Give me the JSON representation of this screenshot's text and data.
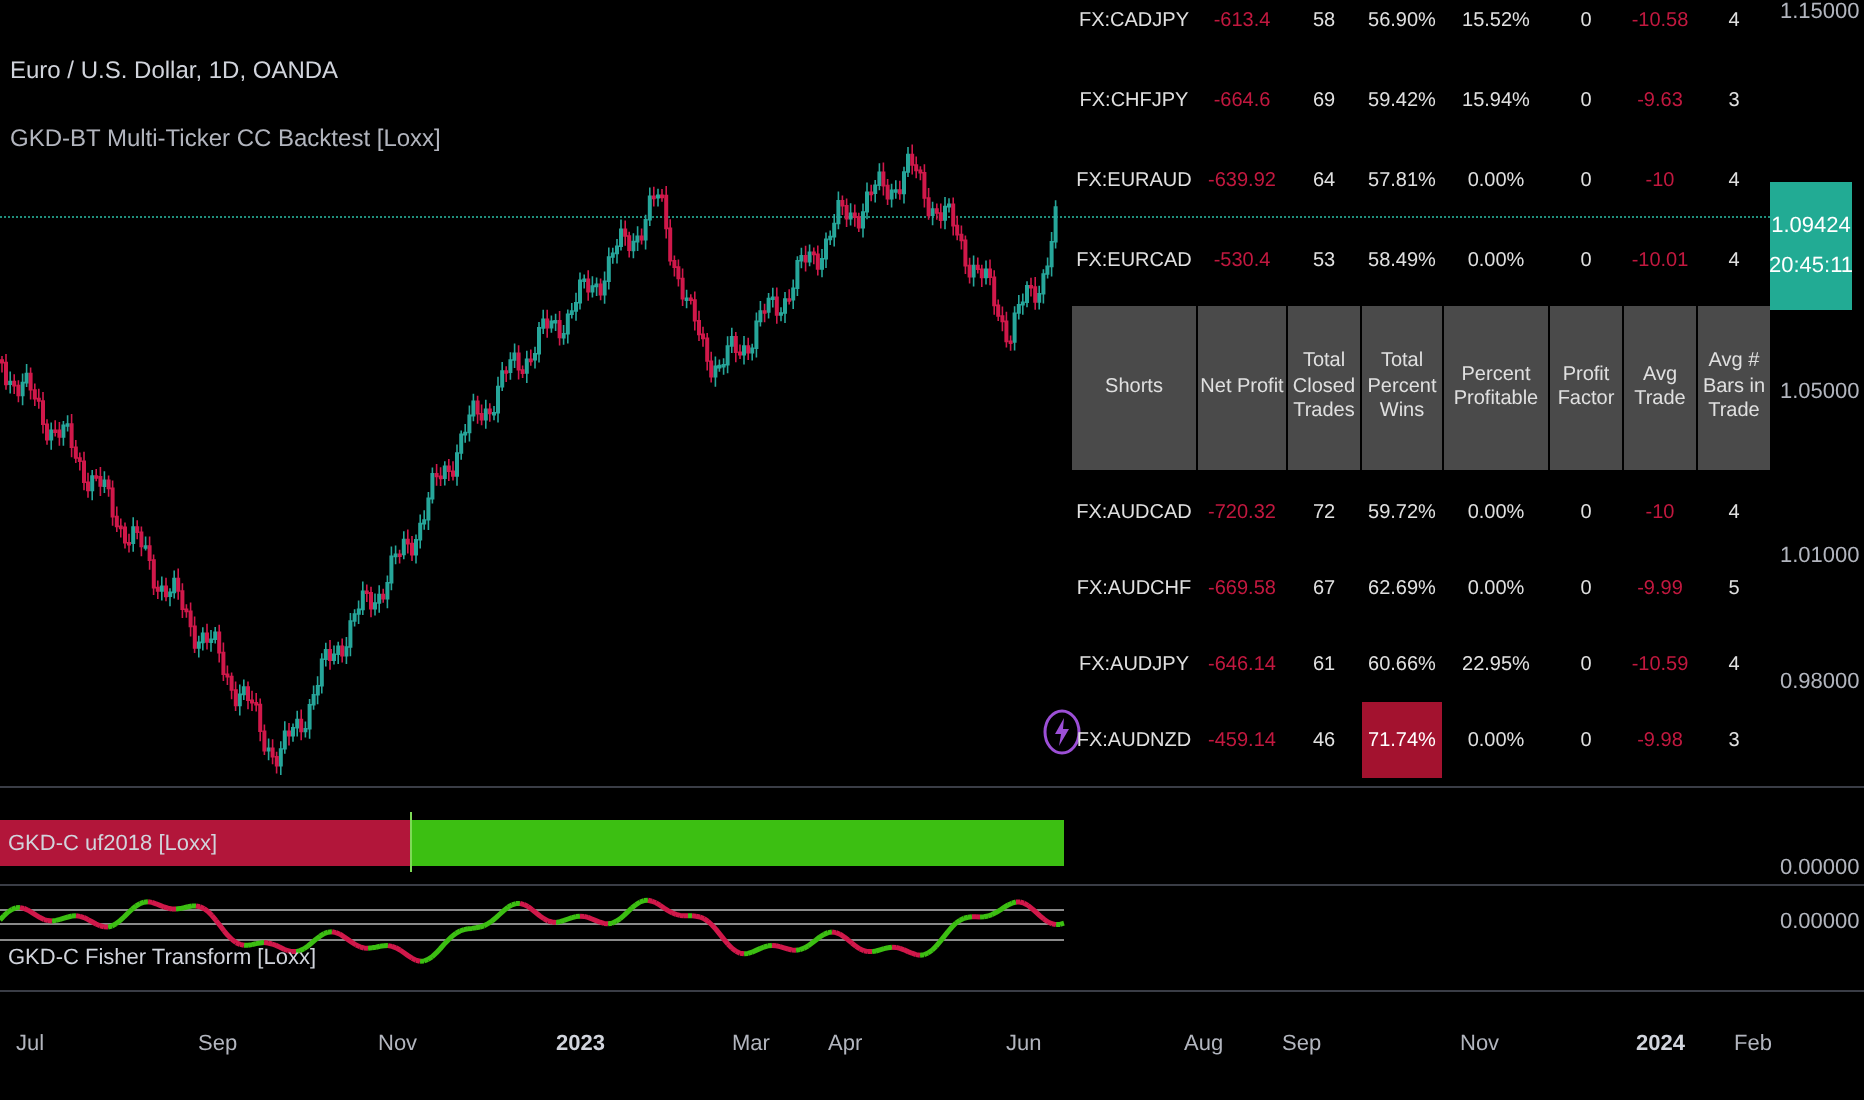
{
  "chart": {
    "symbol_title": "Euro / U.S. Dollar, 1D, OANDA",
    "study_title": "GKD-BT Multi-Ticker CC Backtest [Loxx]"
  },
  "table": {
    "top_rows": [
      {
        "ticker": "FX:CADJPY",
        "net_profit": "-613.4",
        "closed": "58",
        "wins": "56.90%",
        "profitable": "15.52%",
        "factor": "0",
        "avg_trade": "-10.58",
        "bars": "4",
        "wins_highlighted": false
      },
      {
        "ticker": "FX:CHFJPY",
        "net_profit": "-664.6",
        "closed": "69",
        "wins": "59.42%",
        "profitable": "15.94%",
        "factor": "0",
        "avg_trade": "-9.63",
        "bars": "3",
        "wins_highlighted": false
      },
      {
        "ticker": "FX:EURAUD",
        "net_profit": "-639.92",
        "closed": "64",
        "wins": "57.81%",
        "profitable": "0.00%",
        "factor": "0",
        "avg_trade": "-10",
        "bars": "4",
        "wins_highlighted": false
      },
      {
        "ticker": "FX:EURCAD",
        "net_profit": "-530.4",
        "closed": "53",
        "wins": "58.49%",
        "profitable": "0.00%",
        "factor": "0",
        "avg_trade": "-10.01",
        "bars": "4",
        "wins_highlighted": false
      }
    ],
    "header": [
      "Shorts",
      "Net Profit",
      "Total Closed Trades",
      "Total Percent Wins",
      "Percent Profitable",
      "Profit Factor",
      "Avg Trade",
      "Avg # Bars in Trade"
    ],
    "rows": [
      {
        "ticker": "FX:AUDCAD",
        "net_profit": "-720.32",
        "closed": "72",
        "wins": "59.72%",
        "profitable": "0.00%",
        "factor": "0",
        "avg_trade": "-10",
        "bars": "4",
        "wins_highlighted": false
      },
      {
        "ticker": "FX:AUDCHF",
        "net_profit": "-669.58",
        "closed": "67",
        "wins": "62.69%",
        "profitable": "0.00%",
        "factor": "0",
        "avg_trade": "-9.99",
        "bars": "5",
        "wins_highlighted": false
      },
      {
        "ticker": "FX:AUDJPY",
        "net_profit": "-646.14",
        "closed": "61",
        "wins": "60.66%",
        "profitable": "22.95%",
        "factor": "0",
        "avg_trade": "-10.59",
        "bars": "4",
        "wins_highlighted": false
      },
      {
        "ticker": "FX:AUDNZD",
        "net_profit": "-459.14",
        "closed": "46",
        "wins": "71.74%",
        "profitable": "0.00%",
        "factor": "0",
        "avg_trade": "-9.98",
        "bars": "3",
        "wins_highlighted": true
      }
    ]
  },
  "price_axis": {
    "labels": [
      "1.15000",
      "1.05000",
      "1.01000",
      "0.98000"
    ],
    "last_price": "1.09424",
    "countdown": "20:45:11"
  },
  "indicators": [
    {
      "kind": "histogram",
      "title": "GKD-C uf2018 [Loxx]",
      "axis_value": "0.00000"
    },
    {
      "kind": "lines",
      "title": "GKD-C Fisher Transform [Loxx]",
      "axis_value": "0.00000"
    }
  ],
  "time_axis": [
    {
      "label": "Jul",
      "kind": "month"
    },
    {
      "label": "Sep",
      "kind": "month"
    },
    {
      "label": "Nov",
      "kind": "month"
    },
    {
      "label": "2023",
      "kind": "year"
    },
    {
      "label": "Mar",
      "kind": "month"
    },
    {
      "label": "Apr",
      "kind": "month"
    },
    {
      "label": "Jun",
      "kind": "month"
    },
    {
      "label": "Aug",
      "kind": "month"
    },
    {
      "label": "Sep",
      "kind": "month"
    },
    {
      "label": "Nov",
      "kind": "month"
    },
    {
      "label": "2024",
      "kind": "year"
    },
    {
      "label": "Feb",
      "kind": "month"
    }
  ]
}
